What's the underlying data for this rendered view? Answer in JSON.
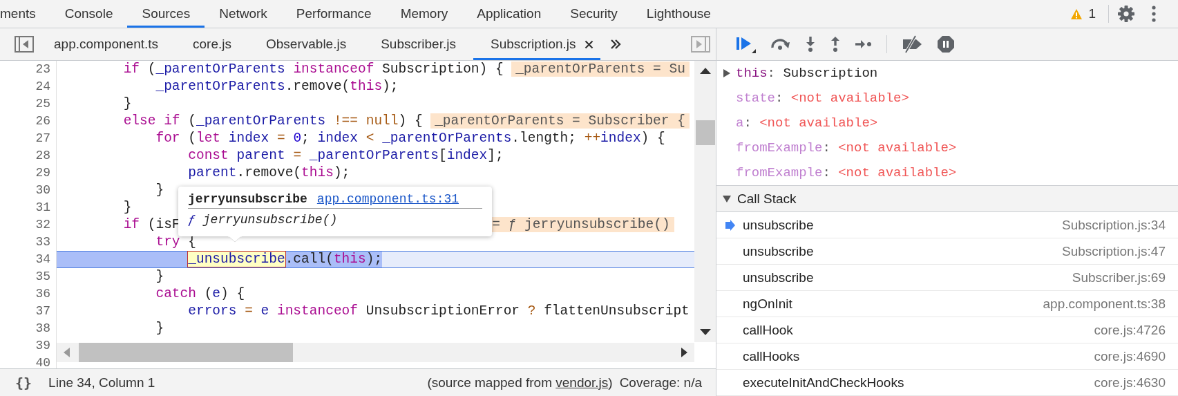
{
  "main_tabs": [
    {
      "label": "ments",
      "selected": false
    },
    {
      "label": "Console",
      "selected": false
    },
    {
      "label": "Sources",
      "selected": true
    },
    {
      "label": "Network",
      "selected": false
    },
    {
      "label": "Performance",
      "selected": false
    },
    {
      "label": "Memory",
      "selected": false
    },
    {
      "label": "Application",
      "selected": false
    },
    {
      "label": "Security",
      "selected": false
    },
    {
      "label": "Lighthouse",
      "selected": false
    }
  ],
  "warnings": {
    "count": "1"
  },
  "file_tabs": [
    {
      "label": "app.component.ts",
      "selected": false,
      "closable": false
    },
    {
      "label": "core.js",
      "selected": false,
      "closable": false
    },
    {
      "label": "Observable.js",
      "selected": false,
      "closable": false
    },
    {
      "label": "Subscriber.js",
      "selected": false,
      "closable": false
    },
    {
      "label": "Subscription.js",
      "selected": true,
      "closable": true
    }
  ],
  "editor": {
    "lines": [
      {
        "number": "23",
        "paused": false,
        "tokens": [
          {
            "kind": "kw",
            "text": "        if"
          },
          {
            "kind": "plain",
            "text": " ("
          },
          {
            "kind": "id",
            "text": "_parentOrParents "
          },
          {
            "kind": "kw",
            "text": "instanceof"
          },
          {
            "kind": "plain",
            "text": " Subscription) {"
          }
        ],
        "inline_value": "_parentOrParents = Su"
      },
      {
        "number": "24",
        "paused": false,
        "tokens": [
          {
            "kind": "id",
            "text": "            _parentOrParents"
          },
          {
            "kind": "plain",
            "text": ".remove("
          },
          {
            "kind": "kw",
            "text": "this"
          },
          {
            "kind": "plain",
            "text": ");"
          }
        ]
      },
      {
        "number": "25",
        "paused": false,
        "tokens": [
          {
            "kind": "plain",
            "text": "        }"
          }
        ]
      },
      {
        "number": "26",
        "paused": false,
        "tokens": [
          {
            "kind": "kw",
            "text": "        else if"
          },
          {
            "kind": "plain",
            "text": " ("
          },
          {
            "kind": "id",
            "text": "_parentOrParents "
          },
          {
            "kind": "op",
            "text": "!== null"
          },
          {
            "kind": "plain",
            "text": ") {"
          }
        ],
        "inline_value": "_parentOrParents = Subscriber {"
      },
      {
        "number": "27",
        "paused": false,
        "tokens": [
          {
            "kind": "kw",
            "text": "            for"
          },
          {
            "kind": "plain",
            "text": " ("
          },
          {
            "kind": "kw",
            "text": "let "
          },
          {
            "kind": "id",
            "text": "index "
          },
          {
            "kind": "op",
            "text": "= "
          },
          {
            "kind": "num",
            "text": "0"
          },
          {
            "kind": "plain",
            "text": "; "
          },
          {
            "kind": "id",
            "text": "index "
          },
          {
            "kind": "op",
            "text": "< "
          },
          {
            "kind": "id",
            "text": "_parentOrParents"
          },
          {
            "kind": "plain",
            "text": ".length; "
          },
          {
            "kind": "op",
            "text": "++"
          },
          {
            "kind": "id",
            "text": "index"
          },
          {
            "kind": "plain",
            "text": ") {"
          }
        ]
      },
      {
        "number": "28",
        "paused": false,
        "tokens": [
          {
            "kind": "kw",
            "text": "                const "
          },
          {
            "kind": "id",
            "text": "parent "
          },
          {
            "kind": "op",
            "text": "= "
          },
          {
            "kind": "id",
            "text": "_parentOrParents"
          },
          {
            "kind": "plain",
            "text": "["
          },
          {
            "kind": "id",
            "text": "index"
          },
          {
            "kind": "plain",
            "text": "];"
          }
        ]
      },
      {
        "number": "29",
        "paused": false,
        "tokens": [
          {
            "kind": "id",
            "text": "                parent"
          },
          {
            "kind": "plain",
            "text": ".remove("
          },
          {
            "kind": "kw",
            "text": "this"
          },
          {
            "kind": "plain",
            "text": ");"
          }
        ]
      },
      {
        "number": "30",
        "paused": false,
        "tokens": [
          {
            "kind": "plain",
            "text": "            }"
          }
        ]
      },
      {
        "number": "31",
        "paused": false,
        "tokens": [
          {
            "kind": "plain",
            "text": "        }"
          }
        ]
      },
      {
        "number": "32",
        "paused": false,
        "tokens": [
          {
            "kind": "kw",
            "text": "        if"
          },
          {
            "kind": "plain",
            "text": " (isF"
          }
        ],
        "inline_value": "= ƒ jerryunsubscribe()"
      },
      {
        "number": "33",
        "paused": false,
        "tokens": [
          {
            "kind": "kw",
            "text": "            try"
          },
          {
            "kind": "plain",
            "text": " {"
          }
        ]
      },
      {
        "number": "34",
        "paused": true,
        "tokens": [
          {
            "kind": "hovered",
            "text": "                _unsubscribe"
          },
          {
            "kind": "plain",
            "text": ".call("
          },
          {
            "kind": "kw",
            "text": "this"
          },
          {
            "kind": "plain",
            "text": ");"
          }
        ]
      },
      {
        "number": "35",
        "paused": false,
        "tokens": [
          {
            "kind": "plain",
            "text": "            }"
          }
        ]
      },
      {
        "number": "36",
        "paused": false,
        "tokens": [
          {
            "kind": "kw",
            "text": "            catch"
          },
          {
            "kind": "plain",
            "text": " ("
          },
          {
            "kind": "id",
            "text": "e"
          },
          {
            "kind": "plain",
            "text": ") {"
          }
        ]
      },
      {
        "number": "37",
        "paused": false,
        "tokens": [
          {
            "kind": "id",
            "text": "                errors "
          },
          {
            "kind": "op",
            "text": "= "
          },
          {
            "kind": "id",
            "text": "e "
          },
          {
            "kind": "kw",
            "text": "instanceof"
          },
          {
            "kind": "plain",
            "text": " UnsubscriptionError "
          },
          {
            "kind": "op",
            "text": "?"
          },
          {
            "kind": "plain",
            "text": " flattenUnsubscript"
          }
        ]
      },
      {
        "number": "38",
        "paused": false,
        "tokens": [
          {
            "kind": "plain",
            "text": "            }"
          }
        ]
      },
      {
        "number": "39",
        "paused": false
      },
      {
        "number": "40",
        "paused": false
      }
    ]
  },
  "tooltip": {
    "name": "jerryunsubscribe",
    "location": "app.component.ts:31",
    "signature_prefix": "ƒ",
    "signature": "jerryunsubscribe()"
  },
  "status_bar": {
    "pretty_print": "{}",
    "position": "Line 34, Column 1",
    "source_prefix": "(source mapped from ",
    "source_link": "vendor.js",
    "source_suffix": ")",
    "coverage": "Coverage: n/a"
  },
  "scope": {
    "this": {
      "name": "this:",
      "value": "Subscription",
      "expanded": false
    },
    "variables": [
      {
        "name": "state:",
        "value": "<not available>"
      },
      {
        "name": "a:",
        "value": "<not available>"
      },
      {
        "name": "fromExample:",
        "value": "<not available>"
      },
      {
        "name": "fromExample:",
        "value": "<not available>"
      }
    ]
  },
  "call_stack": {
    "title": "Call Stack",
    "expanded": true,
    "frames": [
      {
        "name": "unsubscribe",
        "location": "Subscription.js:34",
        "selected": true
      },
      {
        "name": "unsubscribe",
        "location": "Subscription.js:47",
        "selected": false
      },
      {
        "name": "unsubscribe",
        "location": "Subscriber.js:69",
        "selected": false
      },
      {
        "name": "ngOnInit",
        "location": "app.component.ts:38",
        "selected": false
      },
      {
        "name": "callHook",
        "location": "core.js:4726",
        "selected": false
      },
      {
        "name": "callHooks",
        "location": "core.js:4690",
        "selected": false
      },
      {
        "name": "executeInitAndCheckHooks",
        "location": "core.js:4630",
        "selected": false
      }
    ]
  }
}
